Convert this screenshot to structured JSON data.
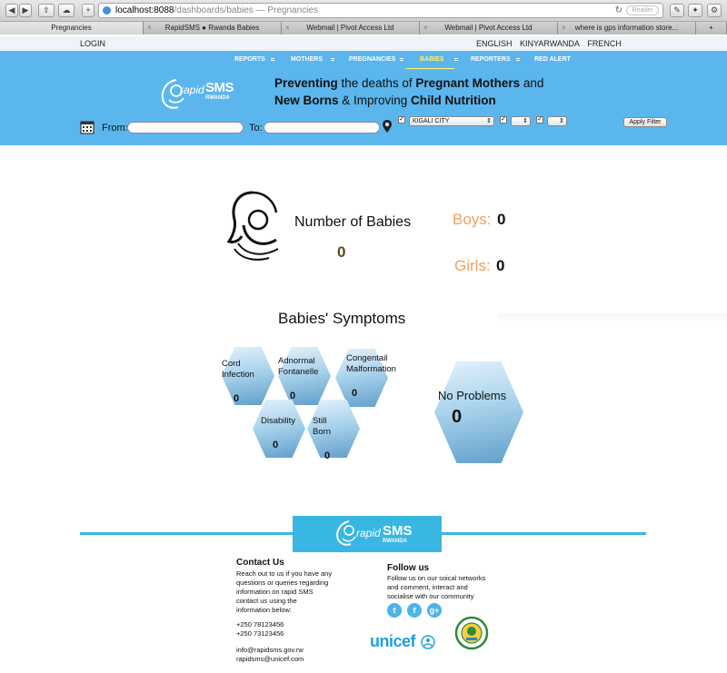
{
  "browser": {
    "url_host": "localhost:8088",
    "url_path": "/dashboards/babies",
    "page_title": " — Pregnancies",
    "reader_label": "Reader",
    "tabs": [
      {
        "label": "Pregnancies"
      },
      {
        "label": "RapidSMS ● Rwanda Babies"
      },
      {
        "label": "Webmail | Pivot Access Ltd"
      },
      {
        "label": "Webmail | Pivot Access Ltd"
      },
      {
        "label": "where is gps information store..."
      }
    ]
  },
  "topbar": {
    "login": "LOGIN",
    "languages": [
      "ENGLISH",
      "KINYARWANDA",
      "FRENCH"
    ]
  },
  "nav": {
    "items": [
      "REPORTS",
      "MOTHERS",
      "PREGNANCIES",
      "BABIES",
      "REPORTERS",
      "RED ALERT"
    ],
    "active": "BABIES"
  },
  "brand": {
    "rapid": "rapid",
    "sms": "SMS",
    "rwanda": "RWANDA"
  },
  "tagline": {
    "w1": "Preventing",
    "w2": " the deaths of ",
    "w3": "Pregnant Mothers",
    "w4": " and ",
    "w5": "New Borns",
    "w6": " & Improving ",
    "w7": "Child Nutrition"
  },
  "filters": {
    "from_label": "From:",
    "to_label": "To:",
    "location_value": "KIGALI CITY",
    "apply_label": "Apply Filter"
  },
  "stats": {
    "num_babies_label": "Number of Babies",
    "num_babies_value": "0",
    "boys_label": "Boys:",
    "boys_value": "0",
    "girls_label": "Girls:",
    "girls_value": "0"
  },
  "symptoms": {
    "title": "Babies' Symptoms",
    "items": [
      {
        "label_l1": "Cord",
        "label_l2": "Infection",
        "count": "0"
      },
      {
        "label_l1": "Adnormal",
        "label_l2": "Fontanelle",
        "count": "0"
      },
      {
        "label_l1": "Congentail",
        "label_l2": "Malformation",
        "count": "0"
      },
      {
        "label_l1": "Disability",
        "label_l2": "",
        "count": "0"
      },
      {
        "label_l1": "Still",
        "label_l2": "Born",
        "count": "0"
      }
    ],
    "no_problems_label": "No Problems",
    "no_problems_value": "0"
  },
  "footer": {
    "contact_title": "Contact Us",
    "contact_l1": "Reach out to us if you have any",
    "contact_l2": "questions or queries regarding",
    "contact_l3": "information on rapid SMS",
    "contact_l4": "contact us using the",
    "contact_l5": "information below:",
    "phone1": "+250 78123456",
    "phone2": "+250 73123456",
    "email1": "info@rapidsms.gov.rw",
    "email2": "rapidsms@unicef.com",
    "follow_title": "Follow us",
    "follow_l1": "Follow us on our soical networks",
    "follow_l2": "and comment, interact and",
    "follow_l3": "socialise with our community",
    "unicef": "unicef"
  }
}
